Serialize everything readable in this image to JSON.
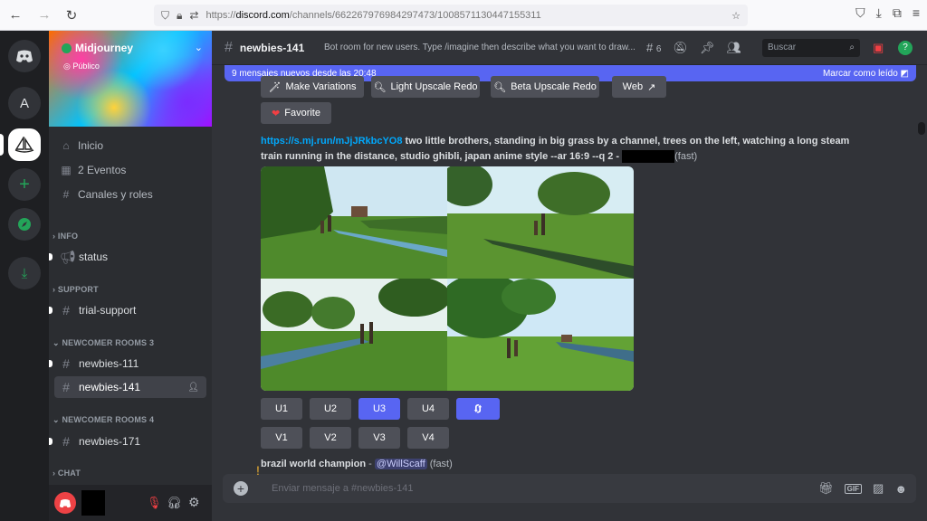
{
  "browser": {
    "url_prefix": "https://",
    "url_host": "discord.com",
    "url_path": "/channels/662267976984297473/1008571130447155311"
  },
  "rail": {
    "servers": [
      {
        "name": "discord-home-icon"
      },
      {
        "label": "A"
      },
      {
        "name": "midjourney-server-icon"
      },
      {
        "name": "add-server-icon"
      },
      {
        "name": "explore-icon"
      },
      {
        "name": "download-icon"
      }
    ]
  },
  "sidebar": {
    "server_name": "Midjourney",
    "public_label": "Público",
    "nav": [
      {
        "label": "Inicio",
        "icon": "home-icon"
      },
      {
        "label": "2 Eventos",
        "icon": "calendar-icon"
      },
      {
        "label": "Canales y roles",
        "icon": "channels-icon"
      }
    ],
    "categories": [
      {
        "label": "INFO"
      },
      {
        "label": "SUPPORT"
      },
      {
        "label": "NEWCOMER ROOMS 3"
      },
      {
        "label": "NEWCOMER ROOMS 4"
      },
      {
        "label": "CHAT"
      }
    ],
    "channels": [
      {
        "label": "status"
      },
      {
        "label": "trial-support"
      },
      {
        "label": "newbies-111"
      },
      {
        "label": "newbies-141"
      },
      {
        "label": "newbies-171"
      }
    ]
  },
  "header": {
    "channel": "newbies-141",
    "topic": "Bot room for new users. Type /imagine then describe what you want to draw...",
    "threads_count": "6",
    "search_placeholder": "Buscar"
  },
  "banner": {
    "text": "9 mensajes nuevos desde las 20:48",
    "mark_read": "Marcar como leído"
  },
  "message": {
    "top_buttons": [
      "Make Variations",
      "Light Upscale Redo",
      "Beta Upscale Redo",
      "Web"
    ],
    "favorite": "Favorite",
    "link": "https://s.mj.run/mJjJRkbcYO8",
    "prompt_line1": " two little brothers, standing in big grass by a channel, trees on the left, watching a long steam",
    "prompt_line2": "train running in the distance, studio ghibli, japan anime style --ar 16:9 --q 2 - ",
    "speed": "(fast)",
    "u_buttons": [
      "U1",
      "U2",
      "U3",
      "U4"
    ],
    "v_buttons": [
      "V1",
      "V2",
      "V3",
      "V4"
    ],
    "next_prompt": "brazil world champion",
    "next_sep": " - ",
    "next_mention": "@WillScaff",
    "next_speed": "(fast)"
  },
  "input": {
    "placeholder": "Enviar mensaje a #newbies-141"
  },
  "colors": {
    "blurple": "#5865f2",
    "link": "#00a8fc",
    "online": "#23a559"
  }
}
